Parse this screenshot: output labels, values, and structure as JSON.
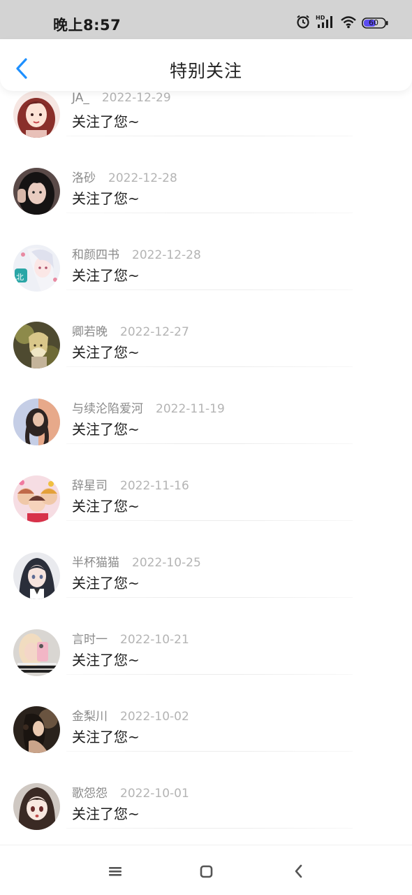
{
  "status_bar": {
    "time": "晚上8:57",
    "icons": [
      "alarm-icon",
      "hd-signal-icon",
      "wifi-icon",
      "battery-icon"
    ],
    "battery_level": "60"
  },
  "header": {
    "back_icon": "chevron-left-icon",
    "title": "特别关注"
  },
  "colors": {
    "accent": "#1e90ff",
    "status_bar_bg": "#d3d3d3",
    "name_text": "#8a8a8a",
    "date_text": "#b4b4b4"
  },
  "list": {
    "items": [
      {
        "name": "JA_",
        "date": "2022-12-29",
        "action": "关注了您~"
      },
      {
        "name": "洛砂",
        "date": "2022-12-28",
        "action": "关注了您~"
      },
      {
        "name": "和颜四书",
        "date": "2022-12-28",
        "action": "关注了您~"
      },
      {
        "name": "卿若晚",
        "date": "2022-12-27",
        "action": "关注了您~"
      },
      {
        "name": "与续沦陷爱河",
        "date": "2022-11-19",
        "action": "关注了您~"
      },
      {
        "name": "辞星司",
        "date": "2022-11-16",
        "action": "关注了您~"
      },
      {
        "name": "半杯猫猫",
        "date": "2022-10-25",
        "action": "关注了您~"
      },
      {
        "name": "言时一",
        "date": "2022-10-21",
        "action": "关注了您~"
      },
      {
        "name": "金梨川",
        "date": "2022-10-02",
        "action": "关注了您~"
      },
      {
        "name": "歌怨怨",
        "date": "2022-10-01",
        "action": "关注了您~"
      }
    ]
  },
  "nav_bar": {
    "buttons": [
      "menu-icon",
      "home-square-icon",
      "back-chevron-icon"
    ]
  }
}
